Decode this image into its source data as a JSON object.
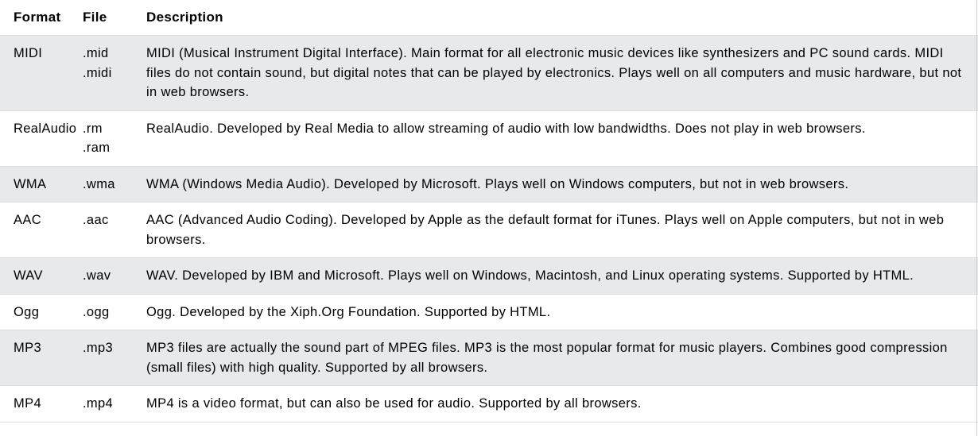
{
  "table": {
    "headers": {
      "format": "Format",
      "file": "File",
      "description": "Description"
    },
    "rows": [
      {
        "format": "MIDI",
        "files": [
          ".mid",
          ".midi"
        ],
        "description": "MIDI (Musical Instrument Digital Interface). Main format for all electronic music devices like synthesizers and PC sound cards. MIDI files do not contain sound, but digital notes that can be played by electronics. Plays well on all computers and music hardware, but not in web browsers."
      },
      {
        "format": "RealAudio",
        "files": [
          ".rm",
          ".ram"
        ],
        "description": "RealAudio. Developed by Real Media to allow streaming of audio with low bandwidths. Does not play in web browsers."
      },
      {
        "format": "WMA",
        "files": [
          ".wma"
        ],
        "description": "WMA (Windows Media Audio). Developed by Microsoft. Plays well on Windows computers, but not in web browsers."
      },
      {
        "format": "AAC",
        "files": [
          ".aac"
        ],
        "description": "AAC (Advanced Audio Coding). Developed by Apple as the default format for iTunes. Plays well on Apple computers, but not in web browsers."
      },
      {
        "format": "WAV",
        "files": [
          ".wav"
        ],
        "description": "WAV. Developed by IBM and Microsoft. Plays well on Windows, Macintosh, and Linux operating systems. Supported by HTML."
      },
      {
        "format": "Ogg",
        "files": [
          ".ogg"
        ],
        "description": "Ogg. Developed by the Xiph.Org Foundation. Supported by HTML."
      },
      {
        "format": "MP3",
        "files": [
          ".mp3"
        ],
        "description": "MP3 files are actually the sound part of MPEG files. MP3 is the most popular format for music players. Combines good compression (small files) with high quality. Supported by all browsers."
      },
      {
        "format": "MP4",
        "files": [
          ".mp4"
        ],
        "description": "MP4 is a video format, but can also be used for audio. Supported by all browsers."
      }
    ]
  }
}
